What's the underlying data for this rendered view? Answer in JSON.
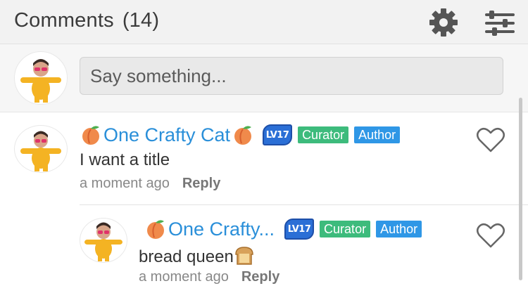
{
  "header": {
    "title": "Comments",
    "count": "(14)",
    "settings_icon": "gear-icon",
    "filter_icon": "sliders-icon"
  },
  "composer": {
    "placeholder": "Say something..."
  },
  "comments": [
    {
      "username": "One Crafty Cat",
      "level": "LV17",
      "badges": [
        "Curator",
        "Author"
      ],
      "text": "I want a title",
      "time": "a moment ago",
      "reply_label": "Reply"
    },
    {
      "username": "One Crafty...",
      "level": "LV17",
      "badges": [
        "Curator",
        "Author"
      ],
      "text": "bread queen",
      "time": "a moment ago",
      "reply_label": "Reply"
    }
  ],
  "colors": {
    "username": "#2a8fd9",
    "curator": "#3dbb7c",
    "author": "#2f97e6",
    "level": "#2b6fd6"
  }
}
